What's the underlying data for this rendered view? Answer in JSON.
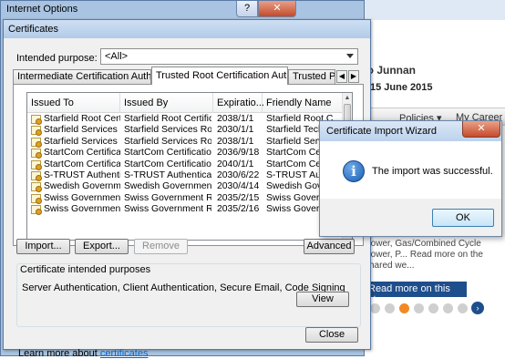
{
  "background_page": {
    "greeting": "llo Junnan",
    "date": "15 June 2015",
    "nav_items": [
      "Policies ▾",
      "My Career ▸"
    ],
    "story_text": "Power, Gas/Combined Cycle Power, P... Read more on the shared we...",
    "read_more_label": "Read more on this story",
    "arrow_glyph": "›"
  },
  "internet_options": {
    "title": "Internet Options",
    "help_glyph": "?",
    "close_glyph": "✕"
  },
  "certificates": {
    "title": "Certificates",
    "intended_purpose_label": "Intended purpose:",
    "intended_purpose_value": "<All>",
    "tabs": [
      {
        "label": "Intermediate Certification Authorities",
        "active": false
      },
      {
        "label": "Trusted Root Certification Authorities",
        "active": true
      },
      {
        "label": "Trusted Publ",
        "active": false
      }
    ],
    "tab_scroll_left": "◀",
    "tab_scroll_right": "▶",
    "columns": [
      "Issued To",
      "Issued By",
      "Expiratio...",
      "Friendly Name"
    ],
    "rows": [
      {
        "issued_to": "Starfield Root Certi...",
        "issued_by": "Starfield Root Certificate...",
        "expiration": "2038/1/1",
        "friendly_name": "Starfield Root C..."
      },
      {
        "issued_to": "Starfield Services R...",
        "issued_by": "Starfield Services Roo...",
        "expiration": "2030/1/1",
        "friendly_name": "Starfield Technol..."
      },
      {
        "issued_to": "Starfield Services R...",
        "issued_by": "Starfield Services Roo...",
        "expiration": "2038/1/1",
        "friendly_name": "Starfield Service..."
      },
      {
        "issued_to": "StartCom Certificati...",
        "issued_by": "StartCom Certification...",
        "expiration": "2036/9/18",
        "friendly_name": "StartCom Certific..."
      },
      {
        "issued_to": "StartCom Certificati...",
        "issued_by": "StartCom Certification...",
        "expiration": "2040/1/1",
        "friendly_name": "StartCom Certific..."
      },
      {
        "issued_to": "S-TRUST Authenticati...",
        "issued_by": "S-TRUST Authenticati...",
        "expiration": "2030/6/22",
        "friendly_name": "S-TRUST Authenti..."
      },
      {
        "issued_to": "Swedish Government ...",
        "issued_by": "Swedish Government ...",
        "expiration": "2030/4/14",
        "friendly_name": "Swedish Governm..."
      },
      {
        "issued_to": "Swiss Government ...",
        "issued_by": "Swiss Government Ro...",
        "expiration": "2035/2/15",
        "friendly_name": "Swiss Governme..."
      },
      {
        "issued_to": "Swiss Government ...",
        "issued_by": "Swiss Government Ro...",
        "expiration": "2035/2/16",
        "friendly_name": "Swiss Governme..."
      }
    ],
    "buttons": {
      "import": "Import...",
      "export": "Export...",
      "remove": "Remove",
      "advanced": "Advanced",
      "view": "View",
      "close": "Close"
    },
    "purposes_legend": "Certificate intended purposes",
    "purposes_value": "Server Authentication, Client Authentication, Secure Email, Code Signing",
    "learn_more_prefix": "Learn more about ",
    "learn_more_link": "certificates"
  },
  "import_wizard": {
    "title": "Certificate Import Wizard",
    "message": "The import was successful.",
    "ok_label": "OK",
    "close_glyph": "✕",
    "info_glyph": "i"
  },
  "colors": {
    "accent": "#1f4e8c",
    "dot_active": "#f08a24",
    "link": "#0066cc"
  }
}
